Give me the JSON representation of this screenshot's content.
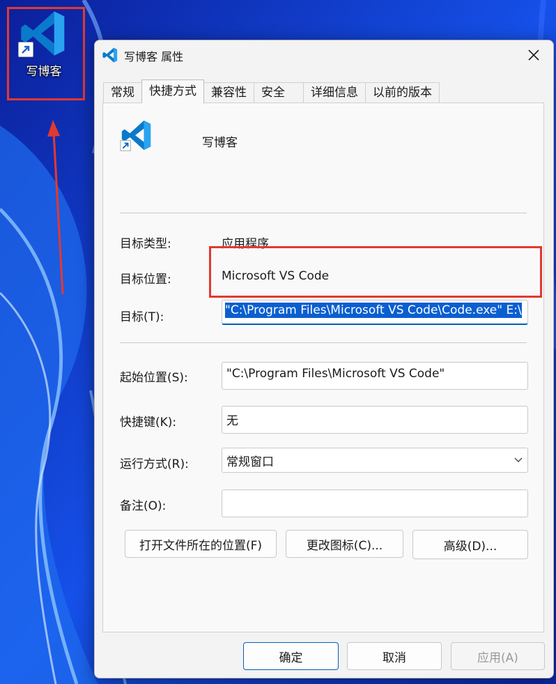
{
  "desktop": {
    "icon_label": "写博客",
    "icon": "vscode-shortcut-icon"
  },
  "dialog": {
    "title": "写博客 属性",
    "tabs": [
      "常规",
      "快捷方式",
      "兼容性",
      "安全",
      "详细信息",
      "以前的版本"
    ],
    "active_tab": "快捷方式",
    "app_name": "写博客",
    "target_type_label": "目标类型:",
    "target_type_value": "应用程序",
    "target_location_label": "目标位置:",
    "target_location_value": "Microsoft VS Code",
    "target_label": "目标(T):",
    "target_value": "\"C:\\Program Files\\Microsoft VS Code\\Code.exe\" E:\\",
    "start_in_label": "起始位置(S):",
    "start_in_value": "\"C:\\Program Files\\Microsoft VS Code\"",
    "shortcut_key_label": "快捷键(K):",
    "shortcut_key_value": "无",
    "run_label": "运行方式(R):",
    "run_value": "常规窗口",
    "comment_label": "备注(O):",
    "comment_value": "",
    "open_location_button": "打开文件所在的位置(F)",
    "change_icon_button": "更改图标(C)...",
    "advanced_button": "高级(D)...",
    "ok_button": "确定",
    "cancel_button": "取消",
    "apply_button": "应用(A)"
  },
  "colors": {
    "annotation_red": "#e3392f",
    "vscode_blue": "#0a7acc",
    "selection_blue": "#0a5fd0"
  }
}
